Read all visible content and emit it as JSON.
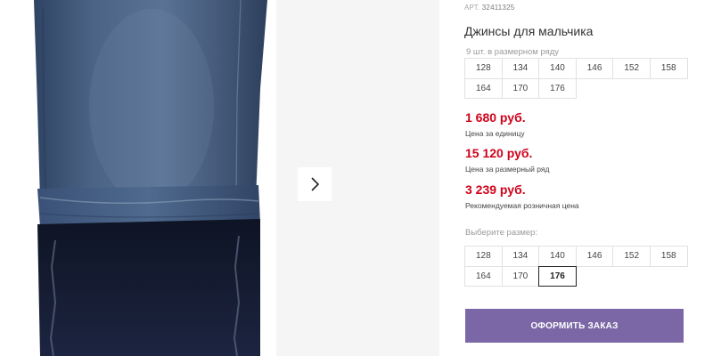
{
  "product": {
    "article_label": "АРТ.",
    "article_value": "32411325",
    "title": "Джинсы для мальчика"
  },
  "size_row": {
    "note": "9 шт. в размерном ряду",
    "sizes": [
      "128",
      "134",
      "140",
      "146",
      "152",
      "158",
      "164",
      "170",
      "176"
    ]
  },
  "prices": [
    {
      "value": "1 680 руб.",
      "label": "Цена за единицу"
    },
    {
      "value": "15 120 руб.",
      "label": "Цена за размерный ряд"
    },
    {
      "value": "3 239 руб.",
      "label": "Рекомендуемая розничная цена"
    }
  ],
  "size_picker": {
    "label": "Выберите размер:",
    "sizes": [
      "128",
      "134",
      "140",
      "146",
      "152",
      "158",
      "164",
      "170",
      "176"
    ],
    "selected": "176"
  },
  "order_button": {
    "label": "ОФОРМИТЬ ЗАКАЗ"
  },
  "gallery": {
    "next_icon": "chevron-right-icon"
  },
  "colors": {
    "price": "#d0021b",
    "button": "#7b67a6",
    "denim": "#3d5575",
    "cuff": "#161c2e"
  }
}
